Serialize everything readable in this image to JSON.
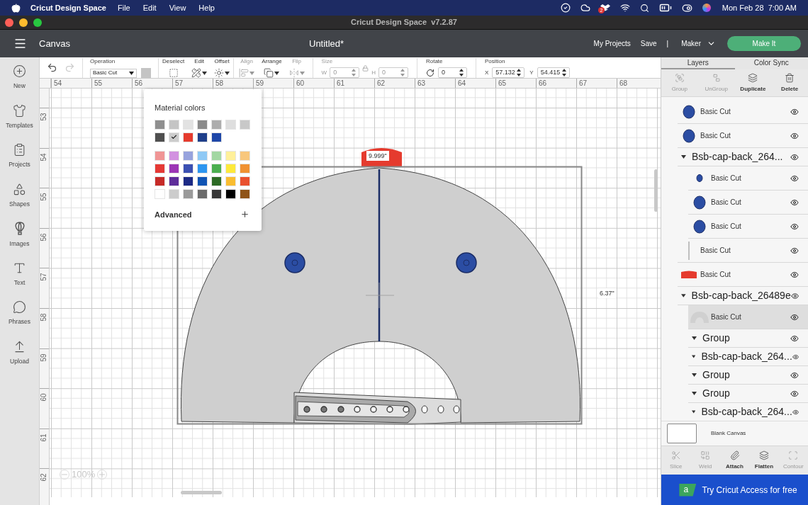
{
  "menubar": {
    "app_name": "Cricut Design Space",
    "menus": [
      "File",
      "Edit",
      "View",
      "Help"
    ],
    "badge": "2",
    "clock": "Mon Feb 28  7:00 AM"
  },
  "window": {
    "title": "Cricut Design Space  v7.2.87"
  },
  "header": {
    "section": "Canvas",
    "document": "Untitled*",
    "links": [
      "My Projects",
      "Save"
    ],
    "separator": "|",
    "machine": "Maker",
    "primary_button": "Make It"
  },
  "sidebar": {
    "items": [
      {
        "label": "New"
      },
      {
        "label": "Templates"
      },
      {
        "label": "Projects"
      },
      {
        "label": "Shapes"
      },
      {
        "label": "Images"
      },
      {
        "label": "Text"
      },
      {
        "label": "Phrases"
      },
      {
        "label": "Upload"
      }
    ]
  },
  "toolbar": {
    "history": [
      {
        "disabled": false
      },
      {
        "disabled": true
      }
    ],
    "operation": {
      "label": "Operation",
      "value": "Basic Cut"
    },
    "tools": [
      {
        "label": "Deselect",
        "disabled": false
      },
      {
        "label": "Edit",
        "disabled": false
      },
      {
        "label": "Offset",
        "disabled": false
      },
      {
        "label": "Align",
        "disabled": true
      },
      {
        "label": "Arrange",
        "disabled": false
      },
      {
        "label": "Flip",
        "disabled": true
      }
    ],
    "size": {
      "label": "Size",
      "disabled": true,
      "w_label": "W",
      "w_value": "0",
      "h_label": "H",
      "h_value": "0"
    },
    "rotate": {
      "label": "Rotate",
      "value": "0"
    },
    "position": {
      "label": "Position",
      "x_label": "X",
      "x_value": "57.132",
      "y_label": "Y",
      "y_value": "54.415"
    }
  },
  "canvas": {
    "top_ruler": [
      "54",
      "55",
      "56",
      "57",
      "58",
      "59",
      "60",
      "61",
      "62",
      "63",
      "64",
      "65",
      "66",
      "67",
      "68"
    ],
    "left_ruler": [
      "53",
      "54",
      "55",
      "56",
      "57",
      "58",
      "59",
      "60",
      "61",
      "62"
    ],
    "width_label": "9.999\"",
    "height_label": "6.37\"",
    "zoom": "100%"
  },
  "color_popup": {
    "title": "Material colors",
    "groups": [
      {
        "rows": [
          [
            {
              "color": "#8f8f8f",
              "selected": false
            },
            {
              "color": "#c4c4c4",
              "selected": false
            },
            {
              "color": "#e2e2e2",
              "selected": false
            },
            {
              "color": "#8a8a8a",
              "selected": false
            },
            {
              "color": "#adadad",
              "selected": false
            },
            {
              "color": "#dedede",
              "selected": false
            },
            {
              "color": "#c8c8c8",
              "selected": false
            }
          ],
          [
            {
              "color": "#4f4f4f",
              "selected": false
            },
            {
              "color": "#cccccc",
              "selected": true
            },
            {
              "color": "#e53b2e",
              "selected": false
            },
            {
              "color": "#1f3f8a",
              "selected": false
            },
            {
              "color": "#1f47a8",
              "selected": false
            }
          ]
        ]
      },
      {
        "rows": [
          [
            {
              "color": "#f09595",
              "selected": false
            },
            {
              "color": "#d291e0",
              "selected": false
            },
            {
              "color": "#97a3dd",
              "selected": false
            },
            {
              "color": "#8fc9f5",
              "selected": false
            },
            {
              "color": "#a3d7a3",
              "selected": false
            },
            {
              "color": "#fff09a",
              "selected": false
            },
            {
              "color": "#f8c77c",
              "selected": false
            }
          ],
          [
            {
              "color": "#e53935",
              "selected": false
            },
            {
              "color": "#9c36b5",
              "selected": false
            },
            {
              "color": "#3b50b2",
              "selected": false
            },
            {
              "color": "#2d96f0",
              "selected": false
            },
            {
              "color": "#4caf50",
              "selected": false
            },
            {
              "color": "#fde93b",
              "selected": false
            },
            {
              "color": "#f09232",
              "selected": false
            }
          ],
          [
            {
              "color": "#c62b28",
              "selected": false
            },
            {
              "color": "#5e2d9a",
              "selected": false
            },
            {
              "color": "#1c2a85",
              "selected": false
            },
            {
              "color": "#1054b4",
              "selected": false
            },
            {
              "color": "#2c6a24",
              "selected": false
            },
            {
              "color": "#f9bd30",
              "selected": false
            },
            {
              "color": "#e9502e",
              "selected": false
            }
          ],
          [
            {
              "color": "#ffffff",
              "selected": false
            },
            {
              "color": "#cccccc",
              "selected": false
            },
            {
              "color": "#9a9a9a",
              "selected": false
            },
            {
              "color": "#6b6b6b",
              "selected": false
            },
            {
              "color": "#383838",
              "selected": false
            },
            {
              "color": "#000000",
              "selected": false
            },
            {
              "color": "#8f5419",
              "selected": false
            }
          ]
        ]
      }
    ],
    "advanced": "Advanced"
  },
  "panel": {
    "tabs": [
      {
        "label": "Layers",
        "selected": true
      },
      {
        "label": "Color Sync",
        "selected": false
      }
    ],
    "top_actions": [
      {
        "label": "Group",
        "disabled": true
      },
      {
        "label": "UnGroup",
        "disabled": true
      },
      {
        "label": "Duplicate",
        "disabled": false
      },
      {
        "label": "Delete",
        "disabled": false
      }
    ],
    "layers": [
      {
        "kind": "oval",
        "label": "Basic Cut",
        "selected": false,
        "visible": true
      },
      {
        "kind": "oval",
        "label": "Basic Cut",
        "selected": false,
        "visible": true
      },
      {
        "kind": "group",
        "label": "Bsb-cap-back_264...",
        "selected": false,
        "visible": true,
        "children": [
          {
            "kind": "dot",
            "label": "Basic Cut",
            "selected": false,
            "visible": true
          },
          {
            "kind": "oval",
            "label": "Basic Cut",
            "selected": false,
            "visible": true
          },
          {
            "kind": "oval",
            "label": "Basic Cut",
            "selected": false,
            "visible": true
          }
        ]
      },
      {
        "kind": "line",
        "label": "Basic Cut",
        "selected": false,
        "visible": true
      },
      {
        "kind": "tab",
        "label": "Basic Cut",
        "selected": false,
        "visible": true
      },
      {
        "kind": "group",
        "label": "Bsb-cap-back_26489e",
        "selected": false,
        "visible": true,
        "children": [
          {
            "kind": "arc",
            "label": "Basic Cut",
            "selected": true,
            "visible": true
          },
          {
            "kind": "group",
            "label": "Group",
            "selected": false,
            "visible": true
          },
          {
            "kind": "group",
            "label": "Bsb-cap-back_264...",
            "selected": false,
            "visible": true
          },
          {
            "kind": "group",
            "label": "Group",
            "selected": false,
            "visible": true
          },
          {
            "kind": "group",
            "label": "Group",
            "selected": false,
            "visible": true
          },
          {
            "kind": "group",
            "label": "Bsb-cap-back_264...",
            "selected": false,
            "visible": true
          }
        ]
      }
    ],
    "blank_canvas": "Blank Canvas",
    "bottom_actions": [
      {
        "label": "Slice",
        "disabled": true
      },
      {
        "label": "Weld",
        "disabled": true
      },
      {
        "label": "Attach",
        "disabled": false
      },
      {
        "label": "Flatten",
        "disabled": false
      },
      {
        "label": "Contour",
        "disabled": true
      }
    ],
    "banner": {
      "logo_letter": "a",
      "text": "Try Cricut Access for free"
    }
  }
}
